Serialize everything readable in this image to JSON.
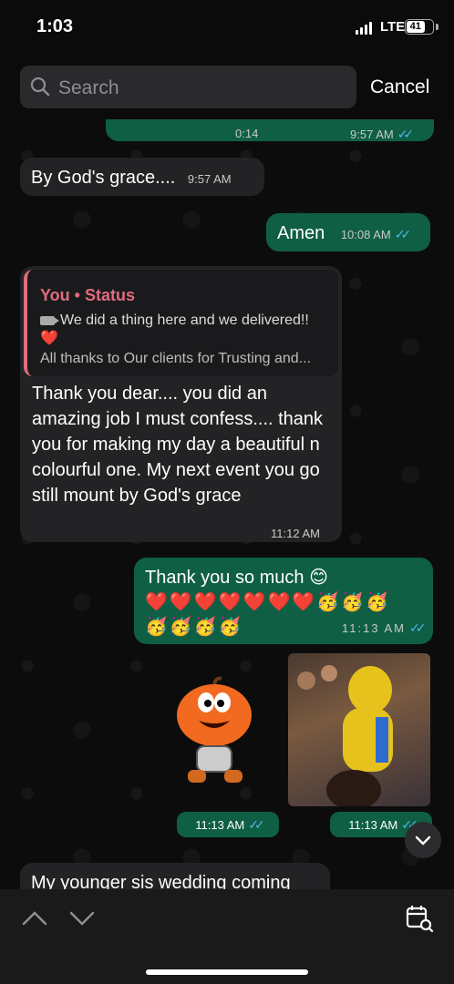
{
  "status": {
    "time": "1:03",
    "network": "LTE",
    "battery": "41"
  },
  "search": {
    "placeholder": "Search",
    "cancel": "Cancel"
  },
  "messages": {
    "video": {
      "duration": "0:14",
      "time": "9:57 AM"
    },
    "grace": {
      "text": "By God's grace....",
      "time": "9:57 AM"
    },
    "amen": {
      "text": "Amen",
      "time": "10:08 AM"
    },
    "thank": {
      "reply_name": "You • Status",
      "reply_line1": "We did a thing here and we delivered!!",
      "reply_heart": "❤️",
      "reply_line2": "All thanks to Our clients for Trusting and...",
      "text": "Thank you dear.... you did an amazing job I must confess.... thank you for making my day a beautiful n colourful one. My next event you go still mount by God's grace",
      "time": "11:12 AM"
    },
    "so_much": {
      "text": "Thank you so much 😊",
      "emojis1": "❤️❤️❤️❤️❤️❤️❤️🥳🥳🥳",
      "emojis2": "🥳🥳🥳🥳",
      "time": "11:13 AM"
    },
    "sticker": {
      "time": "11:13 AM"
    },
    "gif": {
      "time": "11:13 AM"
    },
    "wedding": {
      "text": "My younger sis wedding coming"
    }
  },
  "icons": [
    "search-icon",
    "chevron-up-icon",
    "chevron-down-icon",
    "calendar-search-icon",
    "scroll-down-icon",
    "double-tick-icon",
    "video-camera-icon"
  ],
  "colors": {
    "outgoing": "#0f5f44",
    "incoming": "#232325",
    "reply_accent": "#e06c7e",
    "tick": "#4fb6ec"
  }
}
